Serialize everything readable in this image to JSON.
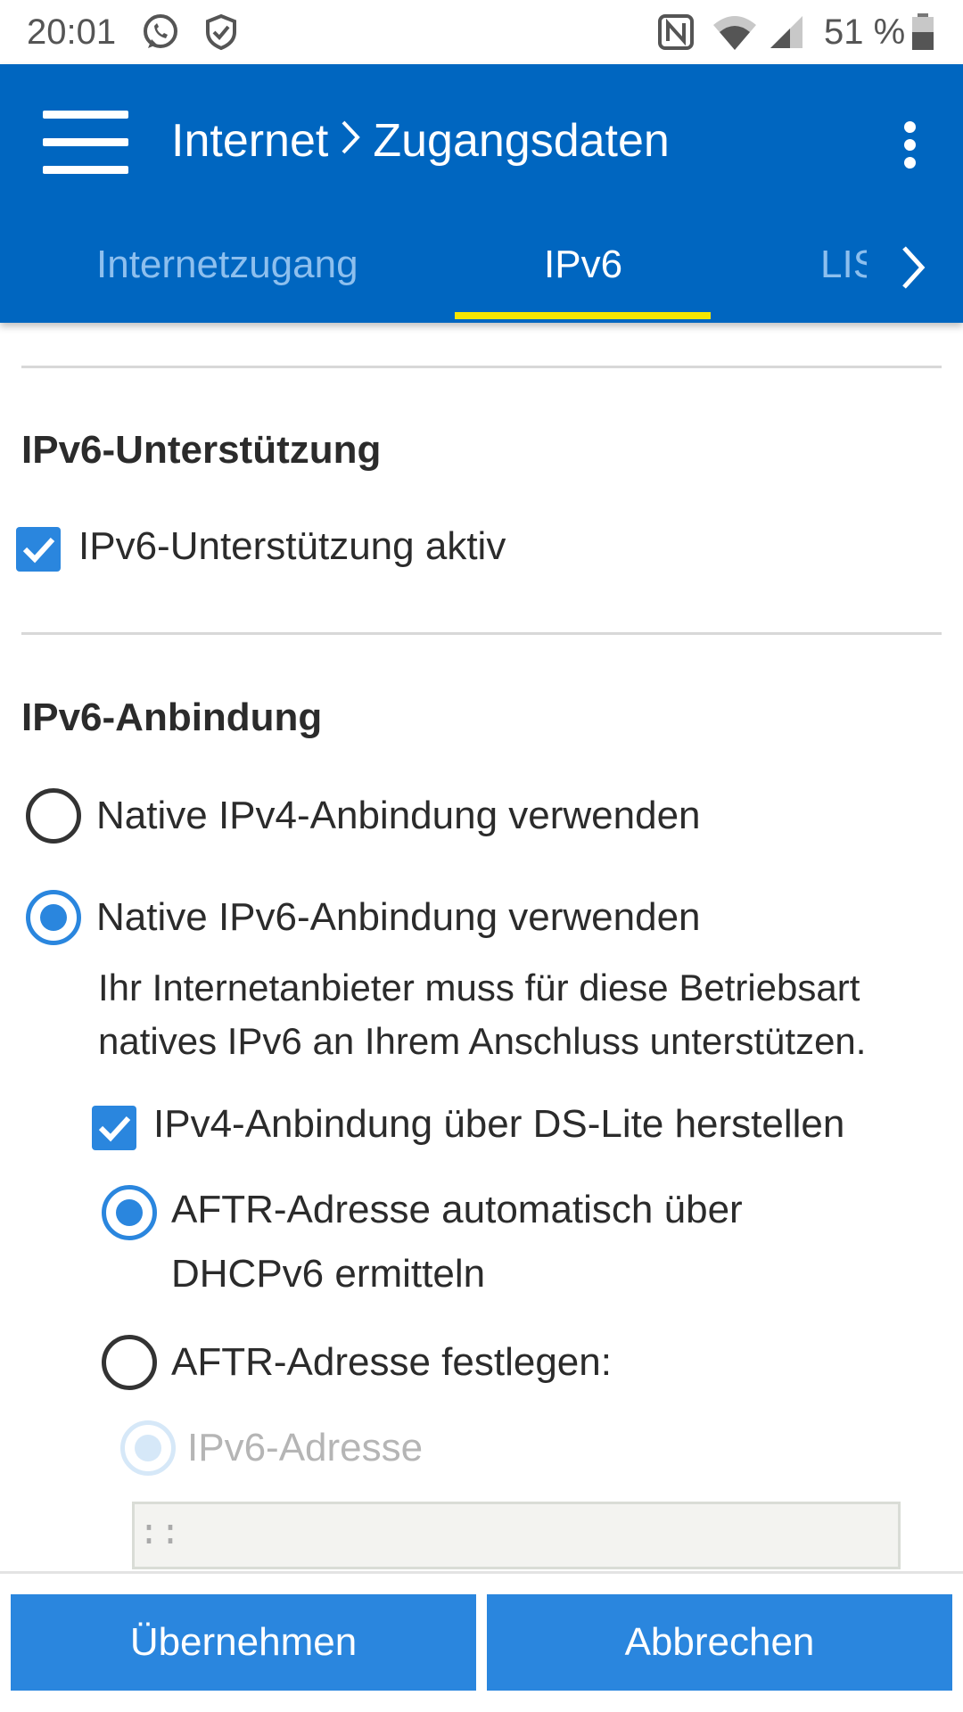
{
  "statusbar": {
    "time": "20:01",
    "icons": [
      "whatsapp-icon",
      "shield-check-icon",
      "nfc-icon",
      "wifi-icon",
      "cellular-signal-icon",
      "battery-icon"
    ],
    "battery": "51 %"
  },
  "appbar": {
    "breadcrumb_parent": "Internet",
    "breadcrumb_separator": ">",
    "breadcrumb_current": "Zugangsdaten",
    "tabs": [
      {
        "label": "Internetzugang",
        "active": false
      },
      {
        "label": "IPv6",
        "active": true
      },
      {
        "label": "LIS",
        "active": false
      }
    ],
    "accent_color": "#0066c0",
    "indicator_color": "#f6e600"
  },
  "support": {
    "title": "IPv6-Unterstützung",
    "checkbox_label": "IPv6-Unterstützung aktiv",
    "checked": true
  },
  "binding": {
    "title": "IPv6-Anbindung",
    "option_native_ipv4": "Native IPv4-Anbindung verwenden",
    "option_native_ipv6": "Native IPv6-Anbindung verwenden",
    "selected": "native_ipv6",
    "hint_line1": "Ihr Internetanbieter muss für diese Betriebsart",
    "hint_line2": "natives IPv6 an Ihrem Anschluss unterstützen.",
    "dslite_label": "IPv4-Anbindung über DS-Lite herstellen",
    "dslite_checked": true,
    "aftr_auto_line1": "AFTR-Adresse automatisch über",
    "aftr_auto_line2": "DHCPv6 ermitteln",
    "aftr_fixed": "AFTR-Adresse festlegen:",
    "aftr_selected": "auto",
    "ipv6_address_label": "IPv6-Adresse",
    "ipv6_address_value": "::"
  },
  "buttons": {
    "apply": "Übernehmen",
    "cancel": "Abbrechen",
    "color": "#2a86de"
  }
}
